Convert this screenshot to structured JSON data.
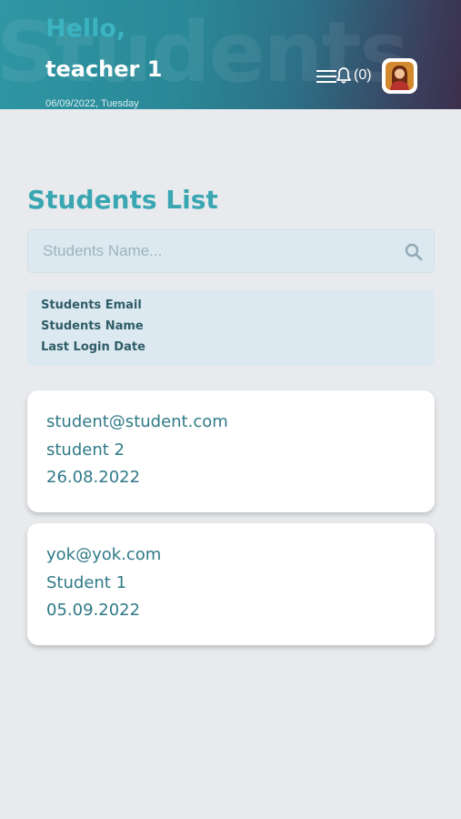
{
  "header": {
    "watermark": "Students",
    "greeting": "Hello,",
    "user_name": "teacher 1",
    "date": "06/09/2022, Tuesday",
    "notifications_count": "(0)"
  },
  "students": {
    "title": "Students List",
    "search_placeholder": "Students Name...",
    "columns": [
      "Students Email",
      "Students Name",
      "Last Login Date"
    ],
    "rows": [
      {
        "email": "student@student.com",
        "name": "student 2",
        "last_login": "26.08.2022"
      },
      {
        "email": "yok@yok.com",
        "name": "Student 1",
        "last_login": "05.09.2022"
      }
    ]
  },
  "colors": {
    "accent": "#3aa6b2",
    "header_dark": "#3b2f4d",
    "text_teal": "#2f7a87",
    "panel": "#dde9f0",
    "background": "#e8eaed"
  },
  "icons": [
    "menu-icon",
    "bell-icon",
    "avatar",
    "search-icon"
  ]
}
